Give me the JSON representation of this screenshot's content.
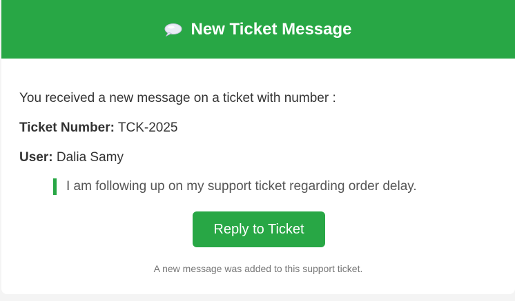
{
  "header": {
    "icon": "speech-bubble-icon",
    "title": "New Ticket Message"
  },
  "message": {
    "intro": "You received a new message on a ticket with number :",
    "ticket_label": "Ticket Number:",
    "ticket_value": "TCK-2025",
    "user_label": "User:",
    "user_value": "Dalia Samy",
    "quote": "I am following up on my support ticket regarding order delay."
  },
  "actions": {
    "reply_label": "Reply to Ticket"
  },
  "footer": {
    "note": "A new message was added to this support ticket."
  },
  "colors": {
    "accent": "#28a745",
    "text": "#333333",
    "muted": "#777777"
  }
}
